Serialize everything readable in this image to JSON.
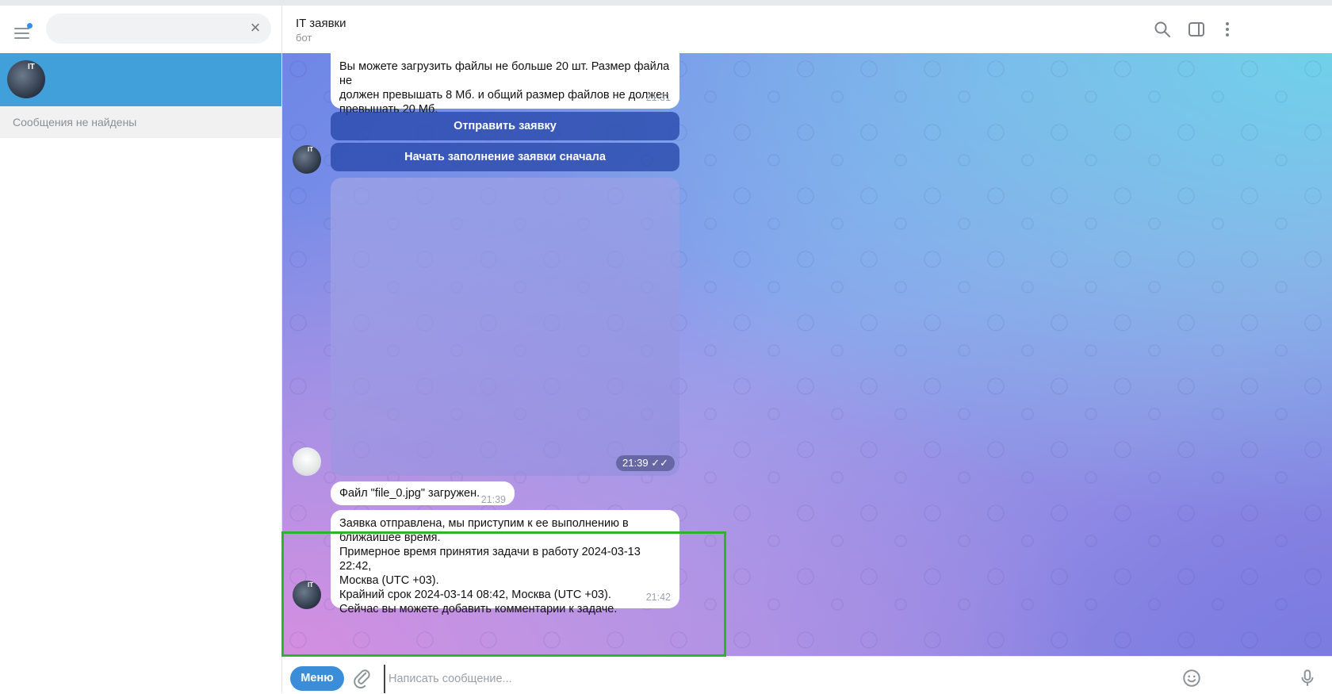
{
  "sidebar": {
    "search_value": "",
    "chat_item": {
      "avatar_text": "IT"
    },
    "no_results": "Сообщения не найдены"
  },
  "header": {
    "title": "IT заявки",
    "subtitle": "бот"
  },
  "messages": {
    "m1": {
      "text": "Вы можете загрузить файлы не больше 20 шт. Размер файла не\nдолжен превышать 8 Мб. и общий размер файлов не должен\nпревышать 20 Мб.",
      "time": "21:31"
    },
    "buttons": [
      "Отправить заявку",
      "Начать заполнение заявки сначала"
    ],
    "photo": {
      "time": "21:39"
    },
    "m2": {
      "text": "Файл \"file_0.jpg\" загружен.",
      "time": "21:39"
    },
    "m3": {
      "text": "Заявка отправлена, мы приступим к ее выполнению в\nближайшее время.\nПримерное время принятия задачи в работу 2024-03-13 22:42,\nМосква (UTC +03).\nКрайний срок 2024-03-14 08:42, Москва (UTC +03).\nСейчас вы можете добавить комментарии к задаче.",
      "time": "21:42"
    },
    "bot_avatar_text": "IT"
  },
  "composer": {
    "menu_label": "Меню",
    "placeholder": "Написать сообщение..."
  },
  "colors": {
    "accent": "#419fd9",
    "menu_button": "#3a8ed9",
    "highlight": "#2bb52b"
  },
  "icons": [
    "menu-icon",
    "close-icon",
    "search-icon",
    "sidebar-toggle-icon",
    "more-icon",
    "attach-icon",
    "emoji-icon",
    "microphone-icon",
    "double-check-icon"
  ]
}
